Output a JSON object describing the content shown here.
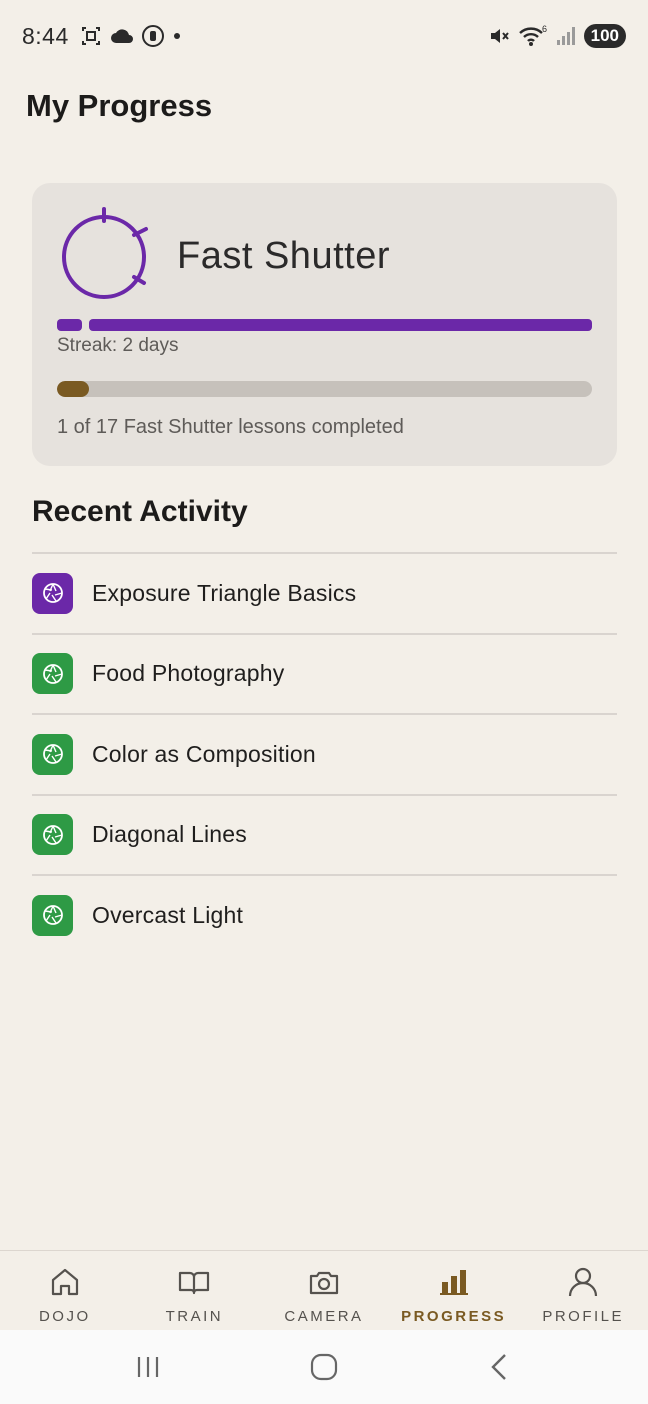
{
  "status_bar": {
    "time": "8:44",
    "signal_label": "6",
    "battery": "100"
  },
  "page_title": "My Progress",
  "course": {
    "title": "Fast Shutter",
    "streak_label": "Streak: 2 days",
    "progress_fraction": 0.059,
    "progress_label": "1 of 17 Fast Shutter lessons completed",
    "accent_color": "#6b28a8",
    "progress_color": "#7a5a22"
  },
  "recent_activity": {
    "title": "Recent Activity",
    "items": [
      {
        "label": "Exposure Triangle Basics",
        "icon": "aperture-icon",
        "color": "#6b28a8"
      },
      {
        "label": "Food Photography",
        "icon": "aperture-icon",
        "color": "#2e9a45"
      },
      {
        "label": "Color as Composition",
        "icon": "aperture-icon",
        "color": "#2e9a45"
      },
      {
        "label": "Diagonal Lines",
        "icon": "aperture-icon",
        "color": "#2e9a45"
      },
      {
        "label": "Overcast Light",
        "icon": "aperture-icon",
        "color": "#2e9a45"
      }
    ]
  },
  "bottom_nav": {
    "items": [
      {
        "label": "DOJO",
        "icon": "home-icon"
      },
      {
        "label": "TRAIN",
        "icon": "book-icon"
      },
      {
        "label": "CAMERA",
        "icon": "camera-icon"
      },
      {
        "label": "PROGRESS",
        "icon": "bar-chart-icon",
        "active": true
      },
      {
        "label": "PROFILE",
        "icon": "person-icon"
      }
    ]
  }
}
